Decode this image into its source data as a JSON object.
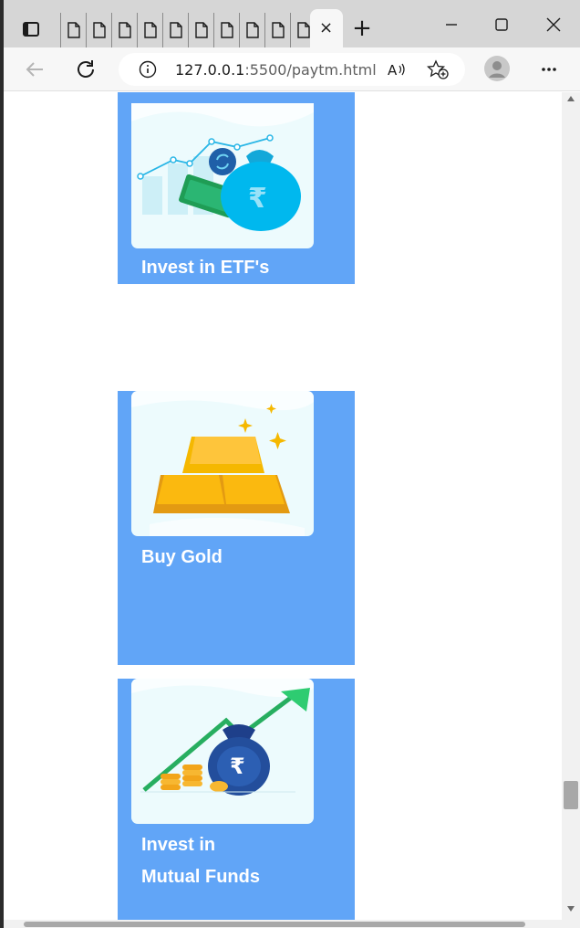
{
  "browser": {
    "url_host": "127.0.0.1",
    "url_path": ":5500/paytm.html",
    "active_tab_close": "×",
    "new_tab": "+"
  },
  "cards": [
    {
      "label": "Invest in ETF's",
      "image": "etf-illustration"
    },
    {
      "label": "Buy Gold",
      "image": "gold-bars-illustration"
    },
    {
      "label_line1": "Invest in",
      "label_line2": "Mutual Funds",
      "image": "mutual-funds-illustration"
    }
  ],
  "colors": {
    "card_bg": "#61a5f7",
    "image_bg": "#edfbfd"
  }
}
